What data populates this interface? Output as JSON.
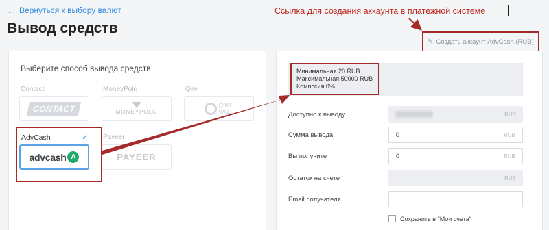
{
  "header": {
    "back_label": "Вернуться к выбору валют",
    "title": "Вывод средств"
  },
  "annotation": {
    "text": "Ссылка для создания аккаунта в платежной системе",
    "color": "#c0271f"
  },
  "create_account": {
    "label": "Создать аккаунт AdvCash (RUB)"
  },
  "methods": {
    "heading": "Выберите способ вывода средств",
    "items": [
      {
        "label": "Contact",
        "logo": "CONTACT",
        "icon": "contact-logo",
        "selected": false
      },
      {
        "label": "MoneyPolo",
        "logo": "MONEYPOLO",
        "icon": "moneypolo-logo",
        "selected": false
      },
      {
        "label": "Qiwi",
        "logo_line1": "QIWI",
        "logo_line2": "WALL",
        "icon": "qiwi-logo",
        "selected": false
      },
      {
        "label": "AdvCash",
        "logo": "advcash",
        "icon": "advcash-logo",
        "selected": true
      },
      {
        "label": "Payeer",
        "logo": "PAYEER",
        "icon": "payeer-logo",
        "selected": false
      }
    ]
  },
  "limits": {
    "min": "Минимальная 20 RUB",
    "max": "Максимальная 50000 RUB",
    "fee": "Комиссия 0%"
  },
  "form": {
    "available": {
      "label": "Доступно к выводу",
      "currency": "RUB"
    },
    "amount": {
      "label": "Сумма вывода",
      "value": "0",
      "currency": "RUB"
    },
    "receive": {
      "label": "Вы получите",
      "value": "0",
      "currency": "RUB"
    },
    "balance": {
      "label": "Остаток на счете",
      "currency": "RUB"
    },
    "email": {
      "label": "Email получателя",
      "value": ""
    },
    "save": {
      "label": "Сохранить в \"Мои счета\"",
      "checked": false
    }
  },
  "colors": {
    "accent": "#2d8ae0",
    "highlight": "#a52a2a",
    "advcash_green": "#1faa6a"
  }
}
